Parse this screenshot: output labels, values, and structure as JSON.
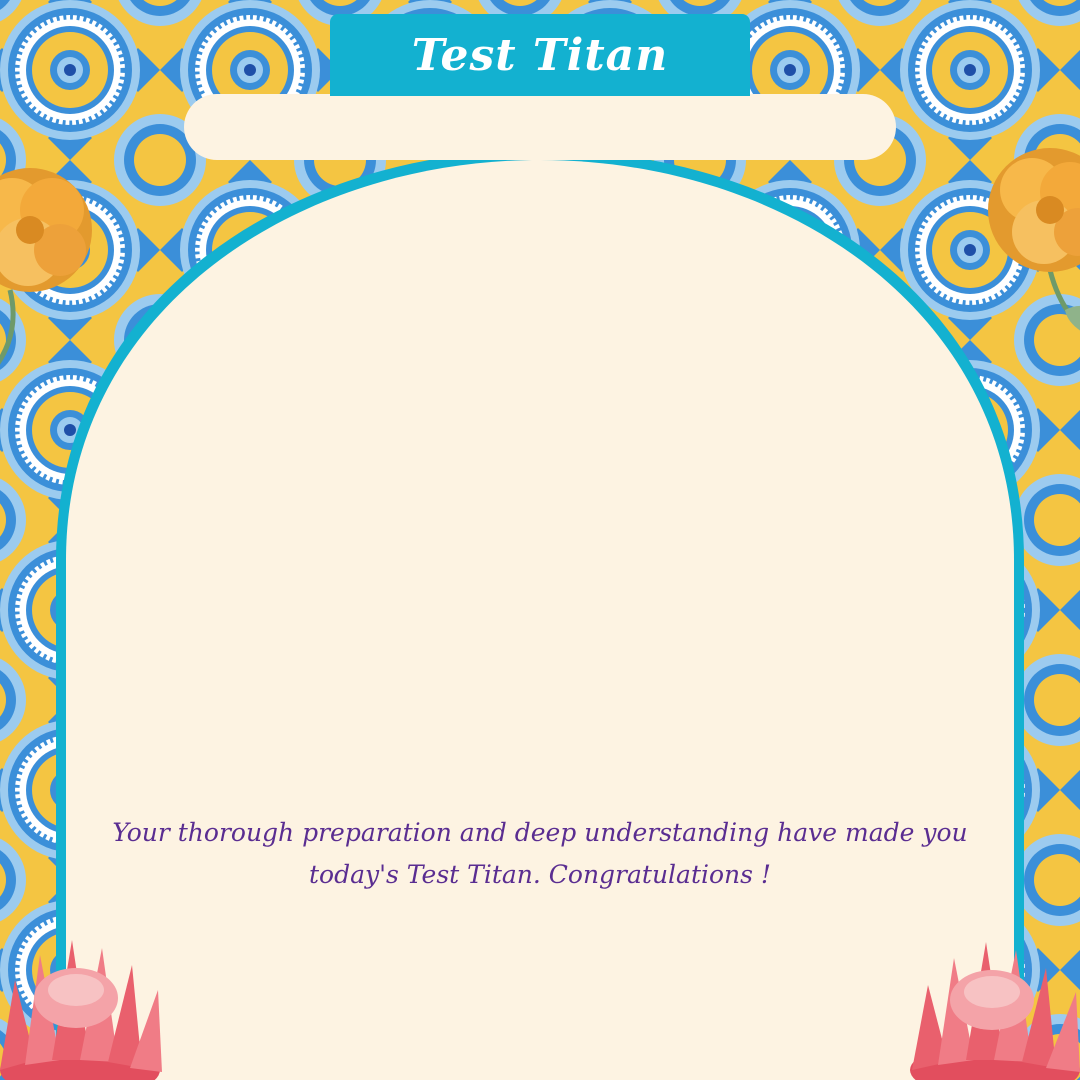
{
  "card": {
    "title": "Test Titan",
    "message": "Your thorough preparation and deep understanding have made you today's Test Titan. Congratulations !"
  },
  "colors": {
    "background": "#f4c542",
    "pattern_blue": "#3b8fd9",
    "pattern_light_blue": "#9ccbef",
    "panel": "#fdf3e2",
    "accent_teal": "#13b1d0",
    "text_purple": "#5a2d91",
    "marigold": "#f3a93a",
    "protea_pink": "#e9606d"
  },
  "decorations": {
    "top_left": "marigold-flower",
    "top_right": "marigold-flower",
    "bottom_left": "protea-flower",
    "bottom_right": "protea-flower"
  }
}
